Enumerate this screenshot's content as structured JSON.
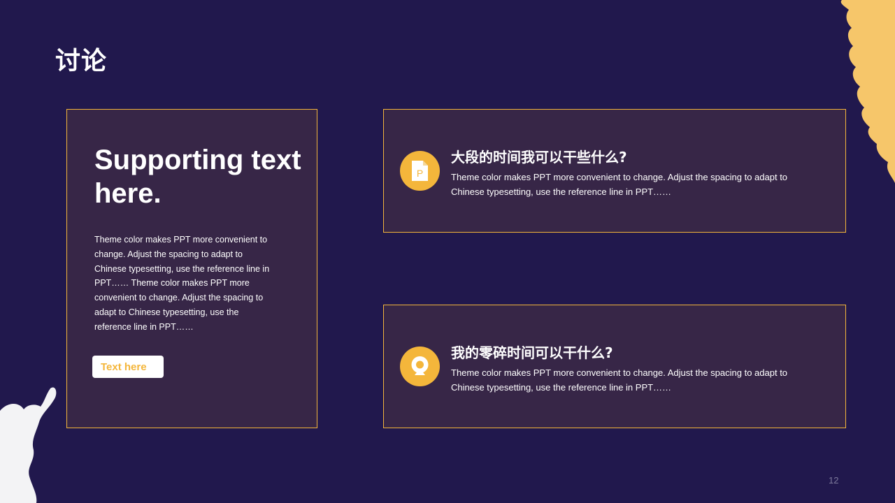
{
  "slide": {
    "title": "讨论",
    "page_number": "12"
  },
  "left_card": {
    "heading": "Supporting text here.",
    "body": "Theme color makes PPT more convenient to change. Adjust the spacing to adapt to Chinese typesetting, use the reference line in PPT…… Theme color makes PPT more convenient  to change. Adjust the spacing to adapt to Chinese  typesetting, use the reference line in PPT……",
    "button_label": "Text here"
  },
  "right_cards": [
    {
      "title": "大段的时间我可以干些什么?",
      "body": "Theme color makes PPT more convenient  to change. Adjust the spacing to adapt to Chinese  typesetting, use the reference line in PPT……",
      "icon": "presentation-file-icon"
    },
    {
      "title": "我的零碎时间可以干什么?",
      "body": "Theme color makes PPT more convenient  to change. Adjust the spacing to adapt to Chinese  typesetting, use the reference line in PPT……",
      "icon": "webcam-icon"
    }
  ],
  "colors": {
    "background": "#21184d",
    "card": "#372647",
    "accent": "#f4b63b",
    "text": "#ffffff",
    "blob_right": "#f6c66a",
    "blob_left": "#f3f3f5"
  }
}
